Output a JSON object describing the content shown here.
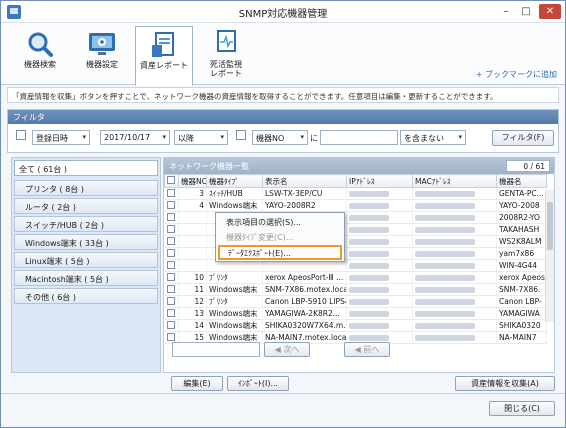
{
  "window": {
    "title": "SNMP対応機器管理",
    "min": "–",
    "max": "□",
    "close": "✕"
  },
  "toolbar": {
    "tabs": [
      {
        "label": "機器検索",
        "icon": "magnifier-icon"
      },
      {
        "label": "機器設定",
        "icon": "monitor-settings-icon"
      },
      {
        "label": "資産レポート",
        "icon": "report-document-icon"
      },
      {
        "label": "死活監視\nレポート",
        "icon": "health-monitor-icon"
      }
    ],
    "bookmark_link": "+ ブックマークに追加"
  },
  "info_text": "「資産情報を収集」ボタンを押すことで、ネットワーク機器の資産情報を取得することができます。任意項目は編集・更新することができます。",
  "filter": {
    "heading": "フィルタ",
    "date_field": "登録日時",
    "date_value": "2017/10/17",
    "date_op": "以降",
    "field2": "機器NO",
    "ni_label": "に",
    "value2": "",
    "op2": "を含まない",
    "button": "フィルタ(F)"
  },
  "categories": {
    "all": "全て ( 61台 )",
    "items": [
      "プリンタ ( 8台 )",
      "ルータ ( 2台 )",
      "スイッチ/HUB ( 2台 )",
      "Windows端末 ( 33台 )",
      "Linux端末 ( 5台 )",
      "Macintosh端末 ( 5台 )",
      "その他 ( 6台 )"
    ]
  },
  "list": {
    "heading": "ネットワーク機器一覧",
    "count": "0 / 61",
    "columns": [
      "",
      "機器NO",
      "機器ﾀｲﾌﾟ",
      "表示名",
      "IPｱﾄﾞﾚｽ",
      "MACｱﾄﾞﾚｽ",
      "機器名"
    ],
    "rows": [
      {
        "no": "3",
        "type": "ｽｲｯﾁ/HUB",
        "name": "LSW-TX-3EP/CU",
        "host": "GENTA-PC..."
      },
      {
        "no": "4",
        "type": "Windows端末",
        "name": "YAYO-2008R2",
        "host": "YAYO-2008"
      },
      {
        "no": "",
        "type": "",
        "name": "",
        "host": "2008R2-YO"
      },
      {
        "no": "",
        "type": "",
        "name": "",
        "host": "TAKAHASH"
      },
      {
        "no": "",
        "type": "",
        "name": "",
        "host": "WS2K8ALM"
      },
      {
        "no": "",
        "type": "",
        "name": "",
        "host": "yam7x86"
      },
      {
        "no": "",
        "type": "",
        "name": "",
        "host": "WIN-4G44"
      },
      {
        "no": "10",
        "type": "ﾌﾟﾘﾝﾀ",
        "name": "xerox ApeosPort-Ⅲ ...",
        "host": "xerox Apeos"
      },
      {
        "no": "11",
        "type": "Windows端末",
        "name": "SNM-7X86.motex.local",
        "host": "SNM-7X86."
      },
      {
        "no": "12",
        "type": "ﾌﾟﾘﾝﾀ",
        "name": "Canon LBP-5910 LIPS4",
        "host": "Canon LBP-"
      },
      {
        "no": "13",
        "type": "Windows端末",
        "name": "YAMAGIWA-2K8R2...",
        "host": "YAMAGIWA"
      },
      {
        "no": "14",
        "type": "Windows端末",
        "name": "SHIKA0320W7X64.m...",
        "host": "SHIKA0320"
      },
      {
        "no": "15",
        "type": "Windows端末",
        "name": "NA-MAIN7.motex.local",
        "host": "NA-MAIN7"
      }
    ],
    "prev_button": "次へ",
    "next_button": "前へ"
  },
  "context_menu": {
    "items": [
      {
        "label": "表示項目の選択(S)...",
        "disabled": false
      },
      {
        "label": "機器ﾀｲﾌﾟ変更(C)...",
        "disabled": true
      },
      {
        "label": "ﾃﾞｰﾀｴｸｽﾎﾟｰﾄ(E)...",
        "disabled": false
      }
    ]
  },
  "footer": {
    "edit": "編集(E)",
    "import": "ｲﾝﾎﾟｰﾄ(I)...",
    "collect": "資産情報を収集(A)",
    "close": "閉じる(C)"
  },
  "colors": {
    "accent": "#3a78c5",
    "highlight": "#e99a2c",
    "close": "#c7463b"
  }
}
